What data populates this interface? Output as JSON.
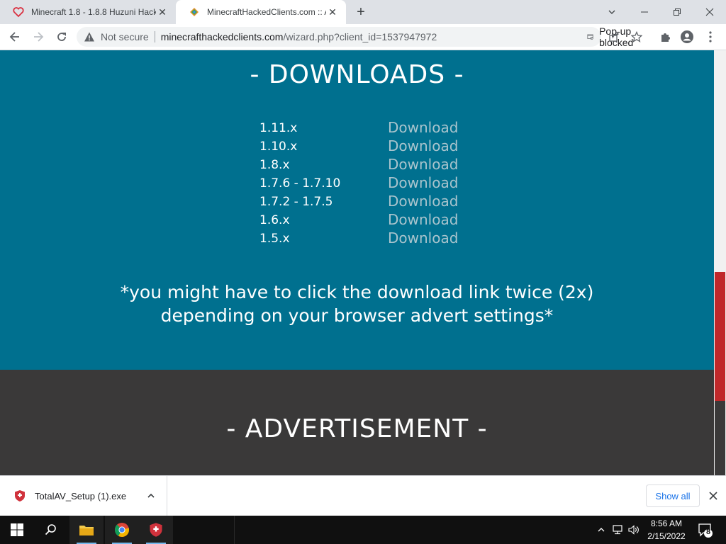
{
  "browser": {
    "tabs": [
      {
        "title": "Minecraft 1.8 - 1.8.8 Huzuni Hack",
        "active": false
      },
      {
        "title": "MinecraftHackedClients.com :: Au",
        "active": true
      }
    ],
    "new_tab_label": "+",
    "omnibox": {
      "security_label": "Not secure",
      "url_domain": "minecrafthackedclients.com",
      "url_path": "/wizard.php?client_id=1537947972",
      "popup_blocked_label": "Pop-up blocked"
    }
  },
  "page": {
    "downloads_heading": "- DOWNLOADS -",
    "downloads": [
      {
        "version": "1.11.x",
        "link": "Download"
      },
      {
        "version": "1.10.x",
        "link": "Download"
      },
      {
        "version": "1.8.x",
        "link": "Download"
      },
      {
        "version": "1.7.6 - 1.7.10",
        "link": "Download"
      },
      {
        "version": "1.7.2 - 1.7.5",
        "link": "Download"
      },
      {
        "version": "1.6.x",
        "link": "Download"
      },
      {
        "version": "1.5.x",
        "link": "Download"
      }
    ],
    "note_line1": "*you might have to click the download link twice (2x)",
    "note_line2": "depending on your browser advert settings*",
    "advertisement_heading": "- ADVERTISEMENT -"
  },
  "download_shelf": {
    "file_name": "TotalAV_Setup (1).exe",
    "show_all_label": "Show all"
  },
  "taskbar": {
    "time": "8:56 AM",
    "date": "2/15/2022",
    "notification_count": "8"
  },
  "colors": {
    "downloads_bg": "#00708f",
    "ad_bg": "#3a3939",
    "link_color": "#a9c4cd",
    "scroll_thumb": "#c0282a"
  }
}
